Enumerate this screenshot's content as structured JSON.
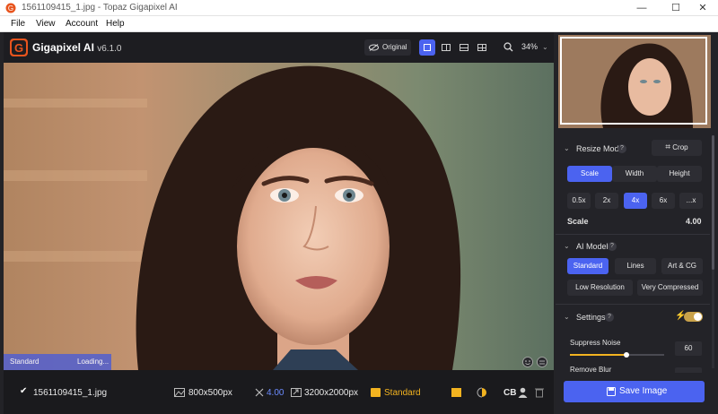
{
  "window": {
    "title": "1561109415_1.jpg - Topaz Gigapixel AI",
    "minimize_glyph": "—",
    "maximize_glyph": "☐",
    "close_glyph": "✕"
  },
  "menu": [
    "File",
    "View",
    "Account",
    "Help"
  ],
  "header": {
    "app_name": "Gigapixel AI",
    "version": "v6.1.0",
    "original_label": "Original",
    "zoom": "34%"
  },
  "image_status": {
    "model": "Standard",
    "status": "Loading..."
  },
  "bottom_bar": {
    "file_name": "1561109415_1.jpg",
    "source_size": "800x500px",
    "scale": "4.00",
    "output_size": "3200x2000px",
    "model": "Standard",
    "cb_label": "CB"
  },
  "panel": {
    "resize_mode": {
      "title": "Resize Mode",
      "help": "?",
      "crop_label": "Crop",
      "tabs": [
        "Scale",
        "Width",
        "Height"
      ],
      "selected_tab": "Scale",
      "scales": [
        "0.5x",
        "2x",
        "4x",
        "6x",
        "...x"
      ],
      "selected_scale": "4x",
      "scale_label": "Scale",
      "scale_value": "4.00"
    },
    "ai_model": {
      "title": "AI Model",
      "help": "?",
      "models_row1": [
        "Standard",
        "Lines",
        "Art & CG"
      ],
      "models_row2": [
        "Low Resolution",
        "Very Compressed"
      ],
      "selected": "Standard"
    },
    "settings": {
      "title": "Settings",
      "help": "?",
      "auto_enabled": true,
      "suppress_noise_label": "Suppress Noise",
      "suppress_noise_value": "60",
      "suppress_noise_level": 0.6,
      "remove_blur_label": "Remove Blur"
    },
    "save_label": "Save Image"
  },
  "colors": {
    "accent": "#4b63f0",
    "warning": "#f2b320",
    "logo": "#e8541d"
  }
}
